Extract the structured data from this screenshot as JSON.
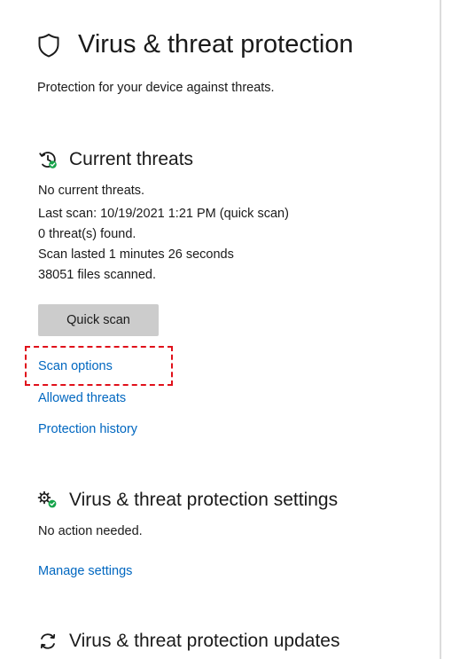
{
  "header": {
    "title": "Virus & threat protection",
    "subtitle": "Protection for your device against threats.",
    "icon": "shield-icon"
  },
  "current_threats": {
    "heading": "Current threats",
    "icon": "clock-refresh-icon",
    "status": "No current threats.",
    "last_scan": "Last scan: 10/19/2021 1:21 PM (quick scan)",
    "threats_found": "0 threat(s) found.",
    "scan_duration": "Scan lasted 1 minutes 26 seconds",
    "files_scanned": "38051 files scanned.",
    "quick_scan_label": "Quick scan",
    "links": {
      "scan_options": "Scan options",
      "allowed_threats": "Allowed threats",
      "protection_history": "Protection history"
    }
  },
  "settings": {
    "heading": "Virus & threat protection settings",
    "icon": "gear-check-icon",
    "status": "No action needed.",
    "manage_link": "Manage settings"
  },
  "updates": {
    "heading": "Virus & threat protection updates",
    "icon": "refresh-icon"
  },
  "colors": {
    "link": "#0067c0",
    "button_bg": "#cccccc",
    "highlight": "#e0101a",
    "ok_green": "#16a34a"
  }
}
